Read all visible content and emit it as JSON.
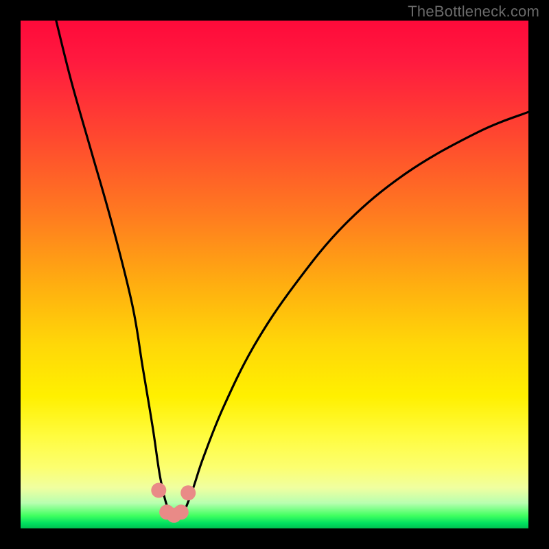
{
  "watermark": "TheBottleneck.com",
  "chart_data": {
    "type": "line",
    "title": "",
    "xlabel": "",
    "ylabel": "",
    "xlim": [
      0,
      100
    ],
    "ylim": [
      0,
      100
    ],
    "series": [
      {
        "name": "curve",
        "x": [
          7,
          10,
          14,
          18,
          22,
          24,
          26,
          27.5,
          29,
          30.5,
          32,
          34,
          36,
          40,
          46,
          54,
          64,
          76,
          90,
          100
        ],
        "values": [
          100,
          88,
          74,
          60,
          44,
          32,
          20,
          10,
          4,
          2.5,
          3,
          8,
          14,
          24,
          36,
          48,
          60,
          70,
          78,
          82
        ]
      }
    ],
    "markers": {
      "name": "highlight-dots",
      "color": "#e98a87",
      "points": [
        {
          "x": 27.2,
          "y": 7.5
        },
        {
          "x": 28.8,
          "y": 3.2
        },
        {
          "x": 30.2,
          "y": 2.6
        },
        {
          "x": 31.6,
          "y": 3.2
        },
        {
          "x": 33.0,
          "y": 7.0
        }
      ]
    },
    "background_gradient": {
      "top": "#ff0a3a",
      "mid1": "#ffae10",
      "mid2": "#fff000",
      "bottom": "#00c050"
    }
  }
}
